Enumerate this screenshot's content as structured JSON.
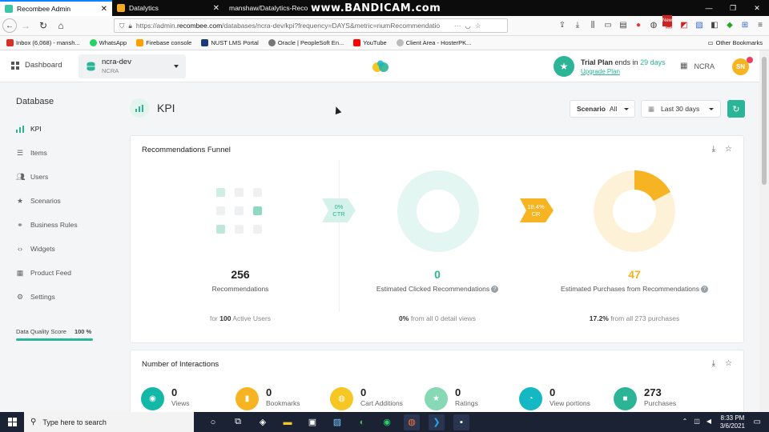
{
  "browser": {
    "tabs": [
      {
        "title": "Recombee Admin",
        "active": true
      },
      {
        "title": "Datalytics",
        "active": false
      },
      {
        "title": "manshaw/Datalytics-Reco",
        "active": false
      }
    ],
    "watermark": "www.BANDICAM.com",
    "url_prefix": "https://admin.",
    "url_domain": "recombee.com",
    "url_rest": "/databases/ncra-dev/kpi?frequency=DAYS&metric=numRecommendatio",
    "url_more": "···",
    "bookmarks": [
      "Inbox (6,068) - mansh...",
      "WhatsApp",
      "Firebase console",
      "NUST LMS Portal",
      "Oracle | PeopleSoft En...",
      "YouTube",
      "Client Area - HosterPK..."
    ],
    "other_bookmarks": "Other Bookmarks",
    "new_badge": "New"
  },
  "header": {
    "dashboard_label": "Dashboard",
    "db_name": "ncra-dev",
    "db_sub": "NCRA",
    "trial_prefix": "Trial Plan",
    "trial_mid": " ends in ",
    "trial_days": "29 days",
    "upgrade_label": "Upgrade Plan",
    "account": "NCRA",
    "avatar": "SN"
  },
  "sidebar": {
    "title": "Database",
    "items": [
      {
        "label": "KPI",
        "icon": "bar-chart-icon",
        "active": true
      },
      {
        "label": "Items",
        "icon": "list-icon"
      },
      {
        "label": "Users",
        "icon": "users-icon"
      },
      {
        "label": "Scenarios",
        "icon": "star-icon"
      },
      {
        "label": "Business Rules",
        "icon": "link-icon"
      },
      {
        "label": "Widgets",
        "icon": "code-icon"
      },
      {
        "label": "Product Feed",
        "icon": "grid-icon"
      },
      {
        "label": "Settings",
        "icon": "gear-icon"
      }
    ],
    "data_quality_label": "Data Quality Score",
    "data_quality_value": "100 %",
    "data_quality_fraction": 1.0
  },
  "main": {
    "title": "KPI",
    "scenario_label": "Scenario",
    "scenario_value": "All",
    "range_value": "Last 30 days",
    "funnel": {
      "title": "Recommendations Funnel",
      "col1": {
        "value": "256",
        "label": "Recommendations",
        "sub_pre": "for ",
        "sub_bold": "100",
        "sub_post": " Active Users"
      },
      "ctr_badge": {
        "value": "0%",
        "label": "CTR"
      },
      "col2": {
        "value": "0",
        "label": "Estimated Clicked Recommendations",
        "sub_bold": "0%",
        "sub_post": " from all 0 detail views",
        "fraction": 0.0
      },
      "cr_badge": {
        "value": "18.4%",
        "label": "CR"
      },
      "col3": {
        "value": "47",
        "label": "Estimated Purchases from Recommendations",
        "sub_bold": "17.2%",
        "sub_post": " from all 273 purchases",
        "fraction": 0.172
      },
      "help": "?"
    },
    "interactions": {
      "title": "Number of Interactions",
      "items": [
        {
          "value": "0",
          "label": "Views",
          "color": "#14b8a6",
          "icon": "eye-icon"
        },
        {
          "value": "0",
          "label": "Bookmarks",
          "color": "#f6b422",
          "icon": "bookmark-icon"
        },
        {
          "value": "0",
          "label": "Cart Additions",
          "color": "#f6c622",
          "icon": "cart-icon"
        },
        {
          "value": "0",
          "label": "Ratings",
          "color": "#86d9b4",
          "icon": "star-icon"
        },
        {
          "value": "0",
          "label": "View portions",
          "color": "#14b8c4",
          "icon": "progress-icon"
        },
        {
          "value": "273",
          "label": "Purchases",
          "color": "#2bb596",
          "icon": "bag-icon"
        }
      ]
    }
  },
  "taskbar": {
    "search_placeholder": "Type here to search",
    "time": "8:33 PM",
    "date": "3/6/2021"
  },
  "colors": {
    "accent": "#2bb596",
    "yellow": "#f6b422"
  }
}
